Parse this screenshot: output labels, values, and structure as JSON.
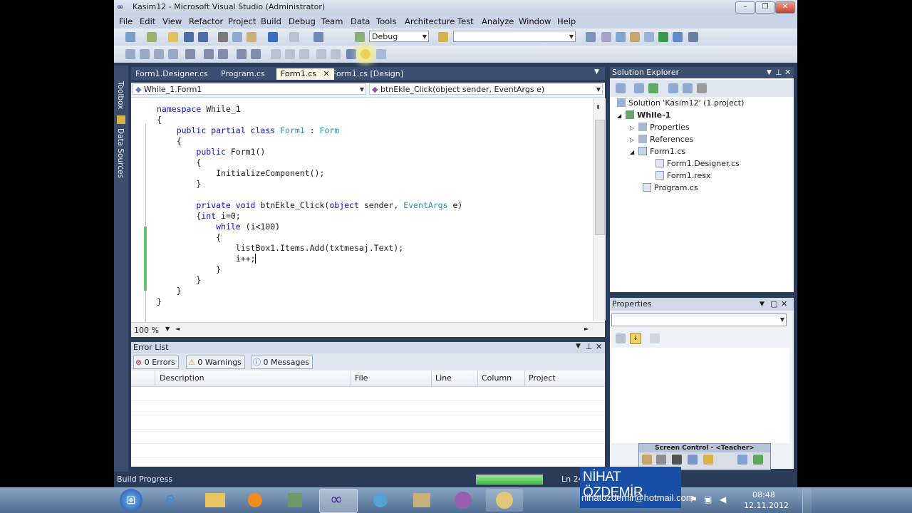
{
  "window": {
    "title": "Kasim12 - Microsoft Visual Studio (Administrator)"
  },
  "menu": [
    "File",
    "Edit",
    "View",
    "Refactor",
    "Project",
    "Build",
    "Debug",
    "Team",
    "Data",
    "Tools",
    "Architecture",
    "Test",
    "Analyze",
    "Window",
    "Help"
  ],
  "toolbar": {
    "config": "Debug"
  },
  "side": {
    "toolbox": "Toolbox",
    "datasources": "Data Sources"
  },
  "tabs": [
    "Form1.Designer.cs",
    "Program.cs",
    "Form1.cs",
    "Form1.cs [Design]"
  ],
  "editor": {
    "nav_left": "While_1.Form1",
    "nav_right": "btnEkle_Click(object sender, EventArgs e)",
    "zoom": "100 %"
  },
  "code": {
    "l1a": "namespace",
    "l1b": " While_1",
    "l2": "{",
    "l3a": "public partial class",
    "l3b": " Form1",
    "l3c": " : ",
    "l3d": "Form",
    "l4": "{",
    "l5a": "public",
    "l5b": " Form1()",
    "l6": "{",
    "l7": "InitializeComponent();",
    "l8": "}",
    "l9a": "private void",
    "l9b": " btnEkle_Click(",
    "l9c": "object",
    "l9d": " sender, ",
    "l9e": "EventArgs",
    "l9f": " e)",
    "l10a": "{",
    "l10b": "int",
    "l10c": " i=0;",
    "l11a": "while",
    "l11b": " (i<100)",
    "l12": "{",
    "l13": "listBox1.Items.Add(txtmesaj.Text);",
    "l14": "i++;",
    "l15": "}",
    "l16": "}",
    "l17": "}",
    "l18": "}"
  },
  "errorlist": {
    "title": "Error List",
    "errors": "0 Errors",
    "warnings": "0 Warnings",
    "messages": "0 Messages",
    "cols": [
      "Description",
      "File",
      "Line",
      "Column",
      "Project"
    ]
  },
  "solution": {
    "title": "Solution Explorer",
    "root": "Solution 'Kasim12' (1 project)",
    "project": "While-1",
    "items": [
      "Properties",
      "References",
      "Form1.cs",
      "Form1.Designer.cs",
      "Form1.resx",
      "Program.cs"
    ]
  },
  "properties": {
    "title": "Properties",
    "screen_control": "Screen Control - <Teacher>"
  },
  "status": {
    "left": "Build Progress",
    "ln": "Ln 24"
  },
  "taskbar": {
    "time": "08:48",
    "date": "12.11.2012"
  },
  "watermark": {
    "name": "NİHAT ÖZDEMİR",
    "email": "nihatozdemir@hotmail.com"
  }
}
